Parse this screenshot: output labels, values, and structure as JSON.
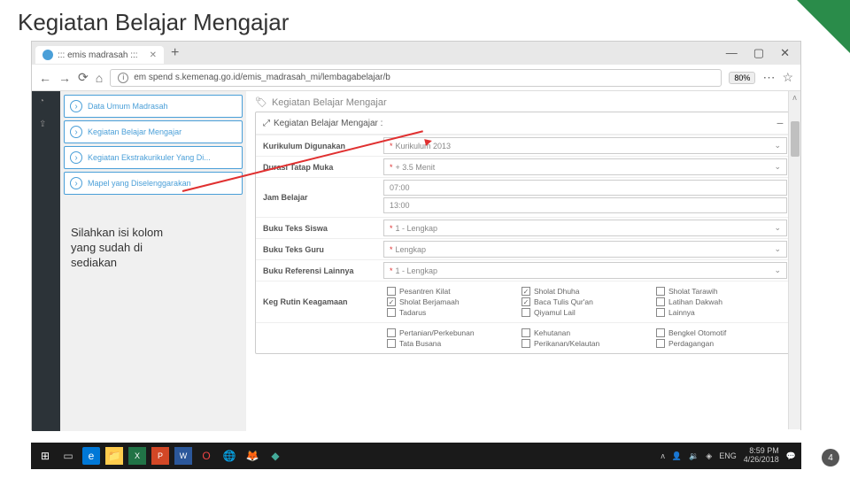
{
  "slide": {
    "title": "Kegiatan Belajar Mengajar",
    "callout": "Silahkan isi kolom\nyang sudah di\nsediakan",
    "page_num": "4"
  },
  "browser": {
    "tab_title": "::: emis madrasah :::",
    "url": "em spend s.kemenag.go.id/emis_madrasah_mi/lembagabelajar/b",
    "zoom": "80%",
    "win": {
      "min": "—",
      "max": "▢",
      "close": "✕"
    }
  },
  "sidebar": {
    "items": [
      {
        "label": "Data Umum Madrasah"
      },
      {
        "label": "Kegiatan Belajar Mengajar"
      },
      {
        "label": "Kegiatan Ekstrakurikuler Yang Di..."
      },
      {
        "label": "Mapel yang Diselenggarakan"
      }
    ]
  },
  "section": {
    "title": "Kegiatan Belajar Mengajar",
    "panel_title": "Kegiatan Belajar Mengajar :"
  },
  "form": {
    "rows": [
      {
        "label": "Kurikulum Digunakan",
        "value": "Kurikulum 2013",
        "type": "select"
      },
      {
        "label": "Durasi Tatap Muka",
        "value": "+ 3.5 Menit",
        "type": "select"
      },
      {
        "label": "Jam Belajar",
        "start": "07:00",
        "end": "13:00",
        "type": "time"
      },
      {
        "label": "Buku Teks Siswa",
        "value": "1 - Lengkap",
        "type": "select"
      },
      {
        "label": "Buku Teks Guru",
        "value": "Lengkap",
        "type": "select"
      },
      {
        "label": "Buku Referensi Lainnya",
        "value": "1 - Lengkap",
        "type": "select"
      }
    ],
    "keg_label": "Keg Rutin Keagamaan",
    "keg_items": [
      {
        "label": "Pesantren Kilat",
        "checked": false
      },
      {
        "label": "Sholat Dhuha",
        "checked": true
      },
      {
        "label": "Sholat Tarawih",
        "checked": false
      },
      {
        "label": "Sholat Berjamaah",
        "checked": true
      },
      {
        "label": "Baca Tulis Qur'an",
        "checked": true
      },
      {
        "label": "Latihan Dakwah",
        "checked": false
      },
      {
        "label": "Tadarus",
        "checked": false
      },
      {
        "label": "Qiyamul Lail",
        "checked": false
      },
      {
        "label": "Lainnya",
        "checked": false
      }
    ],
    "keg2_items": [
      {
        "label": "Pertanian/Perkebunan",
        "checked": false
      },
      {
        "label": "Kehutanan",
        "checked": false
      },
      {
        "label": "Bengkel Otomotif",
        "checked": false
      },
      {
        "label": "Tata Busana",
        "checked": false
      },
      {
        "label": "Perikanan/Kelautan",
        "checked": false
      },
      {
        "label": "Perdagangan",
        "checked": false
      }
    ]
  },
  "taskbar": {
    "lang": "ENG",
    "time": "8:59 PM",
    "date": "4/26/2018"
  }
}
